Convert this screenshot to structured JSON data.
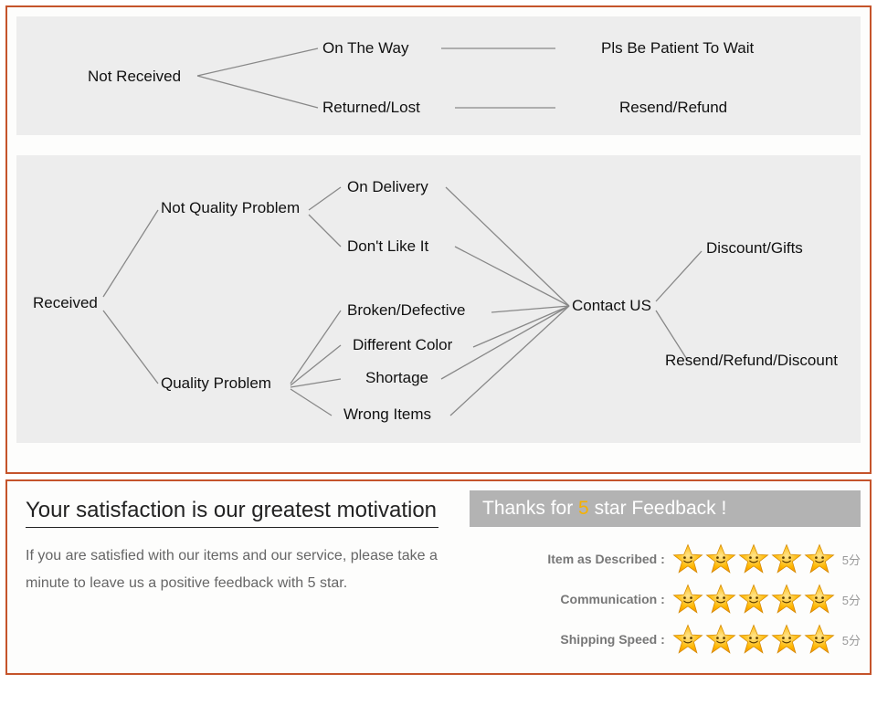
{
  "diagram1": {
    "root": "Not Received",
    "branch_a": "On The Way",
    "branch_b": "Returned/Lost",
    "result_a": "Pls Be Patient To Wait",
    "result_b": "Resend/Refund"
  },
  "diagram2": {
    "root": "Received",
    "group_a": "Not Quality Problem",
    "group_b": "Quality Problem",
    "a_items": [
      "On Delivery",
      "Don't Like It"
    ],
    "b_items": [
      "Broken/Defective",
      "Different Color",
      "Shortage",
      "Wrong Items"
    ],
    "hub": "Contact US",
    "outcome_a": "Discount/Gifts",
    "outcome_b": "Resend/Refund/Discount"
  },
  "feedback": {
    "title": "Your satisfaction is our greatest motivation",
    "body": "If you are satisfied with our items and our service, please take a minute to leave us a positive feedback with 5 star.",
    "banner_pre": "Thanks for ",
    "banner_star": "5",
    "banner_post": " star Feedback !",
    "rows": [
      {
        "label": "Item as Described :",
        "score": "5分"
      },
      {
        "label": "Communication :",
        "score": "5分"
      },
      {
        "label": "Shipping Speed :",
        "score": "5分"
      }
    ]
  }
}
